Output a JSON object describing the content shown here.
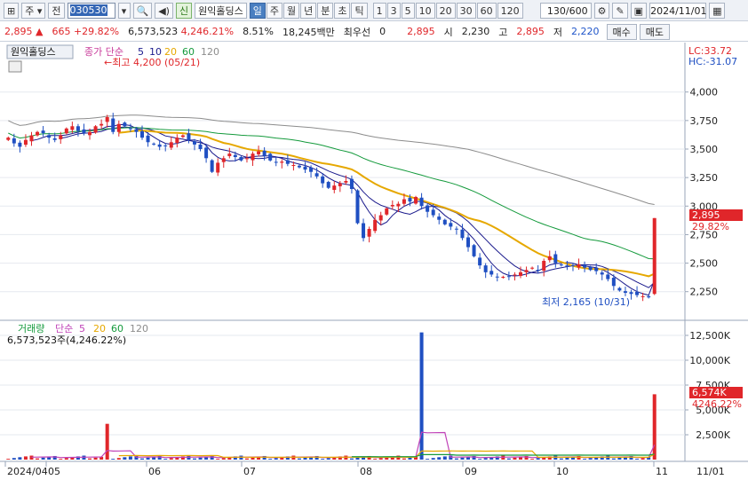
{
  "toolbar": {
    "left_icon": "layout-icon",
    "period_select": "주",
    "prev_label": "전",
    "code": "030530",
    "new_badge": "신",
    "stock_name": "원익홀딩스",
    "period_buttons": [
      {
        "label": "일",
        "selected": true
      },
      {
        "label": "주",
        "selected": false
      },
      {
        "label": "월",
        "selected": false
      },
      {
        "label": "년",
        "selected": false
      },
      {
        "label": "분",
        "selected": false
      },
      {
        "label": "초",
        "selected": false
      },
      {
        "label": "틱",
        "selected": false
      }
    ],
    "interval_buttons": [
      "1",
      "3",
      "5",
      "10",
      "20",
      "30",
      "60",
      "120"
    ],
    "count_display": "130/600",
    "date_value": "2024/11/01"
  },
  "infobar": {
    "price": "2,895",
    "change": "665",
    "change_pct": "+29.82%",
    "volume": "6,573,523",
    "volume_pct": "4,246.21%",
    "turnover": "8.51%",
    "amount": "18,245백만",
    "bid_label": "최우선",
    "bid_value": "0",
    "last_price": "2,895",
    "open_label": "시",
    "open_value": "2,230",
    "high_label": "고",
    "high_value": "2,895",
    "low_label": "저",
    "low_value": "2,220",
    "buy_label": "매수",
    "sell_label": "매도"
  },
  "price_panel": {
    "stock_label": "원익홀딩스",
    "legend_prefix": "종가 단순",
    "ma_labels": [
      "5",
      "10",
      "20",
      "60",
      "120"
    ],
    "ma_colors": [
      "#1a1a8c",
      "#1a1a8c",
      "#e6a800",
      "#149a3c",
      "#8c8c8c"
    ],
    "high_annotation": "←최고 4,200 (05/21)",
    "low_annotation": "최저 2,165 (10/31)",
    "lc_label": "LC:33.72",
    "hc_label": "HC:-31.07",
    "current_price_tag": "2,895",
    "current_pct_tag": "29.82%",
    "y_ticks": [
      "4,000",
      "3,750",
      "3,500",
      "3,250",
      "3,000",
      "2,750",
      "2,500",
      "2,250"
    ]
  },
  "volume_panel": {
    "legend_prefix": "거래량",
    "legend_simple": "단순",
    "ma_labels": [
      "5",
      "20",
      "60",
      "120"
    ],
    "ma_colors": [
      "#c042b8",
      "#e6a800",
      "#149a3c",
      "#8c8c8c"
    ],
    "volume_text": "6,573,523주(4,246.22%)",
    "current_tag": "6,574K",
    "current_pct_tag": "4246.22%",
    "y_ticks": [
      "12,500K",
      "10,000K",
      "7,500K",
      "5,000K",
      "2,500K"
    ]
  },
  "x_axis": {
    "labels": [
      "2024/04",
      "05",
      "06",
      "07",
      "08",
      "09",
      "10",
      "11",
      "11/01"
    ]
  },
  "colors": {
    "up": "#e0262a",
    "down": "#1f4fc2",
    "ma5": "#1a1a8c",
    "ma20": "#e6a800",
    "ma60": "#149a3c",
    "ma120": "#8c8c8c",
    "vol_ma5": "#c042b8"
  },
  "chart_data": {
    "type": "candlestick",
    "title": "원익홀딩스",
    "ylim": [
      2100,
      4200
    ],
    "volume_ylim": [
      0,
      12500
    ],
    "visible_start": "2024/04",
    "visible_end": "2024/11/01",
    "high": {
      "value": 4200,
      "date": "05/21"
    },
    "low": {
      "value": 2165,
      "date": "10/31"
    },
    "last_bar": {
      "open": 2230,
      "high": 2895,
      "low": 2220,
      "close": 2895,
      "volume": 6573523
    },
    "close_series_approx": [
      3600,
      3550,
      3520,
      3580,
      3620,
      3650,
      3640,
      3600,
      3580,
      3620,
      3680,
      3700,
      3660,
      3640,
      3650,
      3700,
      3720,
      3780,
      3650,
      3720,
      3700,
      3680,
      3650,
      3600,
      3560,
      3540,
      3520,
      3530,
      3560,
      3600,
      3620,
      3580,
      3540,
      3500,
      3420,
      3300,
      3380,
      3420,
      3460,
      3430,
      3400,
      3420,
      3460,
      3480,
      3440,
      3400,
      3380,
      3390,
      3370,
      3360,
      3340,
      3320,
      3300,
      3260,
      3200,
      3160,
      3180,
      3200,
      3220,
      3150,
      2850,
      2720,
      2800,
      2880,
      2920,
      2980,
      3010,
      3020,
      3060,
      3040,
      3080,
      3000,
      2950,
      2920,
      2880,
      2840,
      2820,
      2800,
      2720,
      2640,
      2560,
      2480,
      2420,
      2400,
      2380,
      2380,
      2380,
      2400,
      2420,
      2440,
      2460,
      2440,
      2520,
      2560,
      2500,
      2480,
      2470,
      2480,
      2490,
      2460,
      2440,
      2430,
      2400,
      2360,
      2300,
      2260,
      2240,
      2230,
      2220,
      2210,
      2200,
      2895
    ],
    "ma_series_names": [
      "5",
      "10",
      "20",
      "60",
      "120"
    ]
  }
}
